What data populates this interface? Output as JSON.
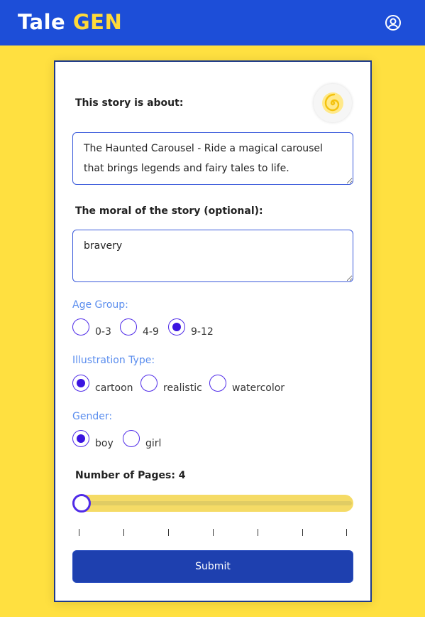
{
  "header": {
    "brand_primary": "Tale",
    "brand_accent": "GEN",
    "user_icon": "user-circle-icon"
  },
  "form": {
    "story_label": "This story is about:",
    "story_value": "The Haunted Carousel - Ride a magical carousel that brings legends and fairy tales to life.",
    "moral_label": "The moral of the story (optional):",
    "moral_value": "bravery",
    "age_group": {
      "label": "Age Group:",
      "options": [
        "0-3",
        "4-9",
        "9-12"
      ],
      "selected": "9-12"
    },
    "illustration_type": {
      "label": "Illustration Type:",
      "options": [
        "cartoon",
        "realistic",
        "watercolor"
      ],
      "selected": "cartoon"
    },
    "gender": {
      "label": "Gender:",
      "options": [
        "boy",
        "girl"
      ],
      "selected": "boy"
    },
    "pages": {
      "label": "Number of Pages: 4",
      "value": 4,
      "fraction": 0
    },
    "submit_label": "Submit"
  },
  "colors": {
    "header_bg": "#1D4ED8",
    "page_bg": "#FFE040",
    "accent_yellow": "#FFDA3A",
    "radio_purple": "#3B14E0",
    "submit_bg": "#1E40AF"
  }
}
